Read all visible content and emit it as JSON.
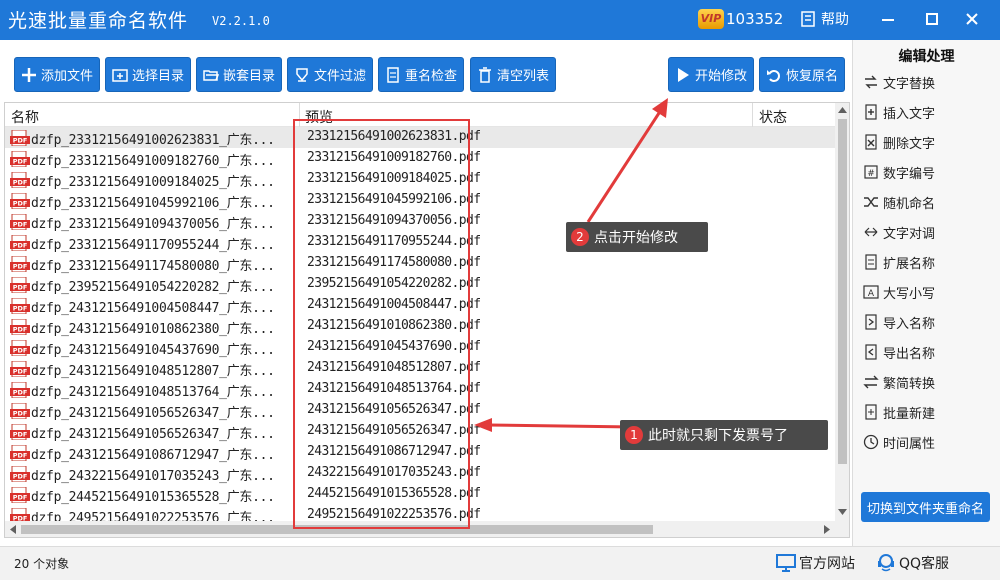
{
  "app": {
    "title": "光速批量重命名软件",
    "version": "V2.2.1.0",
    "vip_badge": "VIP",
    "vip_count": "103352",
    "help_label": "帮助"
  },
  "toolbar": {
    "add_file": "添加文件",
    "select_dir": "选择目录",
    "nested_dir": "嵌套目录",
    "file_filter": "文件过滤",
    "rename_check": "重名检查",
    "clear_list": "清空列表",
    "start_modify": "开始修改",
    "restore_name": "恢复原名"
  },
  "table": {
    "headers": {
      "name": "名称",
      "preview": "预览",
      "status": "状态"
    },
    "rows": [
      {
        "name": "dzfp_23312156491002623831_广东...",
        "preview": "23312156491002623831.pdf"
      },
      {
        "name": "dzfp_23312156491009182760_广东...",
        "preview": "23312156491009182760.pdf"
      },
      {
        "name": "dzfp_23312156491009184025_广东...",
        "preview": "23312156491009184025.pdf"
      },
      {
        "name": "dzfp_23312156491045992106_广东...",
        "preview": "23312156491045992106.pdf"
      },
      {
        "name": "dzfp_23312156491094370056_广东...",
        "preview": "23312156491094370056.pdf"
      },
      {
        "name": "dzfp_23312156491170955244_广东...",
        "preview": "23312156491170955244.pdf"
      },
      {
        "name": "dzfp_23312156491174580080_广东...",
        "preview": "23312156491174580080.pdf"
      },
      {
        "name": "dzfp_23952156491054220282_广东...",
        "preview": "23952156491054220282.pdf"
      },
      {
        "name": "dzfp_24312156491004508447_广东...",
        "preview": "24312156491004508447.pdf"
      },
      {
        "name": "dzfp_24312156491010862380_广东...",
        "preview": "24312156491010862380.pdf"
      },
      {
        "name": "dzfp_24312156491045437690_广东...",
        "preview": "24312156491045437690.pdf"
      },
      {
        "name": "dzfp_24312156491048512807_广东...",
        "preview": "24312156491048512807.pdf"
      },
      {
        "name": "dzfp_24312156491048513764_广东...",
        "preview": "24312156491048513764.pdf"
      },
      {
        "name": "dzfp_24312156491056526347_广东...",
        "preview": "24312156491056526347.pdf"
      },
      {
        "name": "dzfp_24312156491056526347_广东...",
        "preview": "24312156491056526347.pdf"
      },
      {
        "name": "dzfp_24312156491086712947_广东...",
        "preview": "24312156491086712947.pdf"
      },
      {
        "name": "dzfp_24322156491017035243_广东...",
        "preview": "24322156491017035243.pdf"
      },
      {
        "name": "dzfp_24452156491015365528_广东...",
        "preview": "24452156491015365528.pdf"
      },
      {
        "name": "dzfp_24952156491022253576_广东...",
        "preview": "24952156491022253576.pdf"
      }
    ]
  },
  "side_panel": {
    "title": "编辑处理",
    "items": [
      "文字替换",
      "插入文字",
      "删除文字",
      "数字编号",
      "随机命名",
      "文字对调",
      "扩展名称",
      "大写小写",
      "导入名称",
      "导出名称",
      "繁简转换",
      "批量新建",
      "时间属性"
    ],
    "switch_button": "切换到文件夹重命名"
  },
  "annotations": {
    "callout_1_num": "1",
    "callout_1_text": "此时就只剩下发票号了",
    "callout_2_num": "2",
    "callout_2_text": "点击开始修改"
  },
  "statusbar": {
    "count": "20 个对象",
    "website": "官方网站",
    "qq_service": "QQ客服"
  },
  "colors": {
    "accent": "#1f78d8",
    "annotation_red": "#e23b3b",
    "callout_bg": "#4a4a4a"
  }
}
